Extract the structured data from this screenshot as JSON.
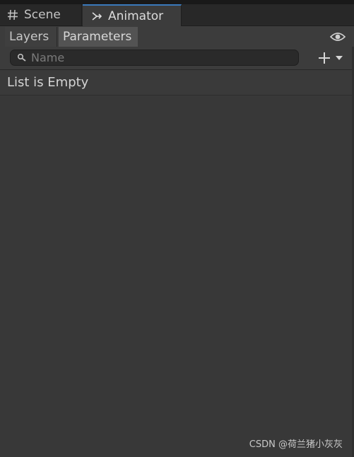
{
  "tabs": {
    "scene": {
      "label": "Scene",
      "icon": "grid-icon"
    },
    "animator": {
      "label": "Animator",
      "icon": "animator-icon",
      "active": true
    }
  },
  "toolbar": {
    "layers_label": "Layers",
    "parameters_label": "Parameters",
    "selected": "Parameters",
    "visibility_icon": "eye-icon"
  },
  "search": {
    "placeholder": "Name",
    "value": ""
  },
  "add_button": {
    "icon": "plus-icon",
    "dropdown_icon": "caret-down-icon"
  },
  "list": {
    "empty_text": "List is Empty"
  },
  "watermark": {
    "text": "CSDN @荷兰猪小灰灰"
  },
  "colors": {
    "background": "#383838",
    "tab_accent": "#3a79bb",
    "selected_segment": "#535353"
  }
}
